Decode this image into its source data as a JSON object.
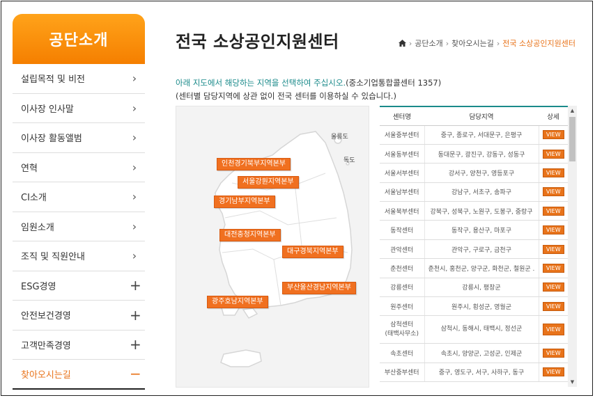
{
  "sidebar": {
    "title": "공단소개",
    "items": [
      {
        "label": "설립목적 및 비전",
        "indicator": "›"
      },
      {
        "label": "이사장 인사말",
        "indicator": "›"
      },
      {
        "label": "이사장 활동앨범",
        "indicator": "›"
      },
      {
        "label": "연혁",
        "indicator": "›"
      },
      {
        "label": "CI소개",
        "indicator": "›"
      },
      {
        "label": "임원소개",
        "indicator": "›"
      },
      {
        "label": "조직 및 직원안내",
        "indicator": "›"
      },
      {
        "label": "ESG경영",
        "indicator": "+"
      },
      {
        "label": "안전보건경영",
        "indicator": "+"
      },
      {
        "label": "고객만족경영",
        "indicator": "+"
      },
      {
        "label": "찾아오시는길",
        "indicator": "−"
      }
    ]
  },
  "header": {
    "title": "전국 소상공인지원센터",
    "breadcrumb": [
      "공단소개",
      "찾아오시는길",
      "전국 소상공인지원센터"
    ]
  },
  "intro": {
    "line1_highlight": "아래 지도에서 해당하는 지역을 선택하여 주십시오.",
    "line1_rest": "(중소기업통합콜센터 1357)",
    "line2": "(센터별 담당지역에 상관 없이 전국 센터를 이용하실 수 있습니다.)"
  },
  "map": {
    "islands": [
      "울릉도",
      "독도"
    ],
    "regions": [
      "인천경기북부지역본부",
      "서울강원지역본부",
      "경기남부지역본부",
      "대전충청지역본부",
      "대구경북지역본부",
      "부산울산경남지역본부",
      "광주호남지역본부"
    ]
  },
  "table": {
    "headers": [
      "센터명",
      "담당지역",
      "상세"
    ],
    "view_label": "VIEW",
    "rows": [
      {
        "name": "서울중부센터",
        "area": "중구, 종로구, 서대문구, 은평구"
      },
      {
        "name": "서울동부센터",
        "area": "동대문구, 광진구, 강동구, 성동구"
      },
      {
        "name": "서울서부센터",
        "area": "강서구, 양천구, 영등포구"
      },
      {
        "name": "서울남부센터",
        "area": "강남구, 서초구, 송파구"
      },
      {
        "name": "서울북부센터",
        "area": "강북구, 성북구, 노원구, 도봉구, 중랑구"
      },
      {
        "name": "동작센터",
        "area": "동작구, 용산구, 마포구"
      },
      {
        "name": "관악센터",
        "area": "관악구, 구로구, 금천구"
      },
      {
        "name": "춘천센터",
        "area": "춘천시, 홍천군, 양구군, 화천군, 철원군 ."
      },
      {
        "name": "강릉센터",
        "area": "강릉시, 평창군"
      },
      {
        "name": "원주센터",
        "area": "원주시, 횡성군, 영월군"
      },
      {
        "name": "삼척센터\n(태백사무소)",
        "area": "삼척시, 동해시, 태백시, 정선군"
      },
      {
        "name": "속초센터",
        "area": "속초시, 양양군, 고성군, 인제군"
      },
      {
        "name": "부산중부센터",
        "area": "중구, 영도구, 서구, 사하구, 동구"
      }
    ]
  },
  "colors": {
    "accent": "#e8731a",
    "teal": "#1a8a8a"
  }
}
